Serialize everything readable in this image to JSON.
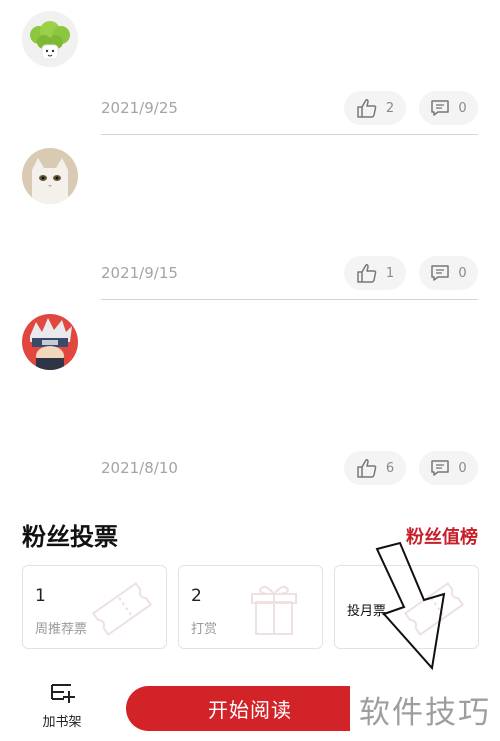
{
  "comments": [
    {
      "date": "2021/9/25",
      "likes": "2",
      "replies": "0",
      "avatar": "broccoli-avatar"
    },
    {
      "date": "2021/9/15",
      "likes": "1",
      "replies": "0",
      "avatar": "cat-avatar"
    },
    {
      "date": "2021/8/10",
      "likes": "6",
      "replies": "0",
      "avatar": "ninja-avatar"
    }
  ],
  "fan_vote": {
    "title": "粉丝投票",
    "rank_link": "粉丝值榜",
    "cards": [
      {
        "number": "1",
        "label": "周推荐票",
        "icon": "ticket-icon"
      },
      {
        "number": "2",
        "label": "打赏",
        "icon": "gift-icon"
      },
      {
        "number": "",
        "label": "投月票",
        "icon": "ticket-icon"
      }
    ]
  },
  "bottom_bar": {
    "add_shelf_label": "加书架",
    "read_button_label": "开始阅读"
  },
  "watermark": "软件技巧",
  "colors": {
    "accent": "#d22328",
    "pill_bg": "#f4f4f4",
    "muted_text": "#a4a4a4"
  }
}
